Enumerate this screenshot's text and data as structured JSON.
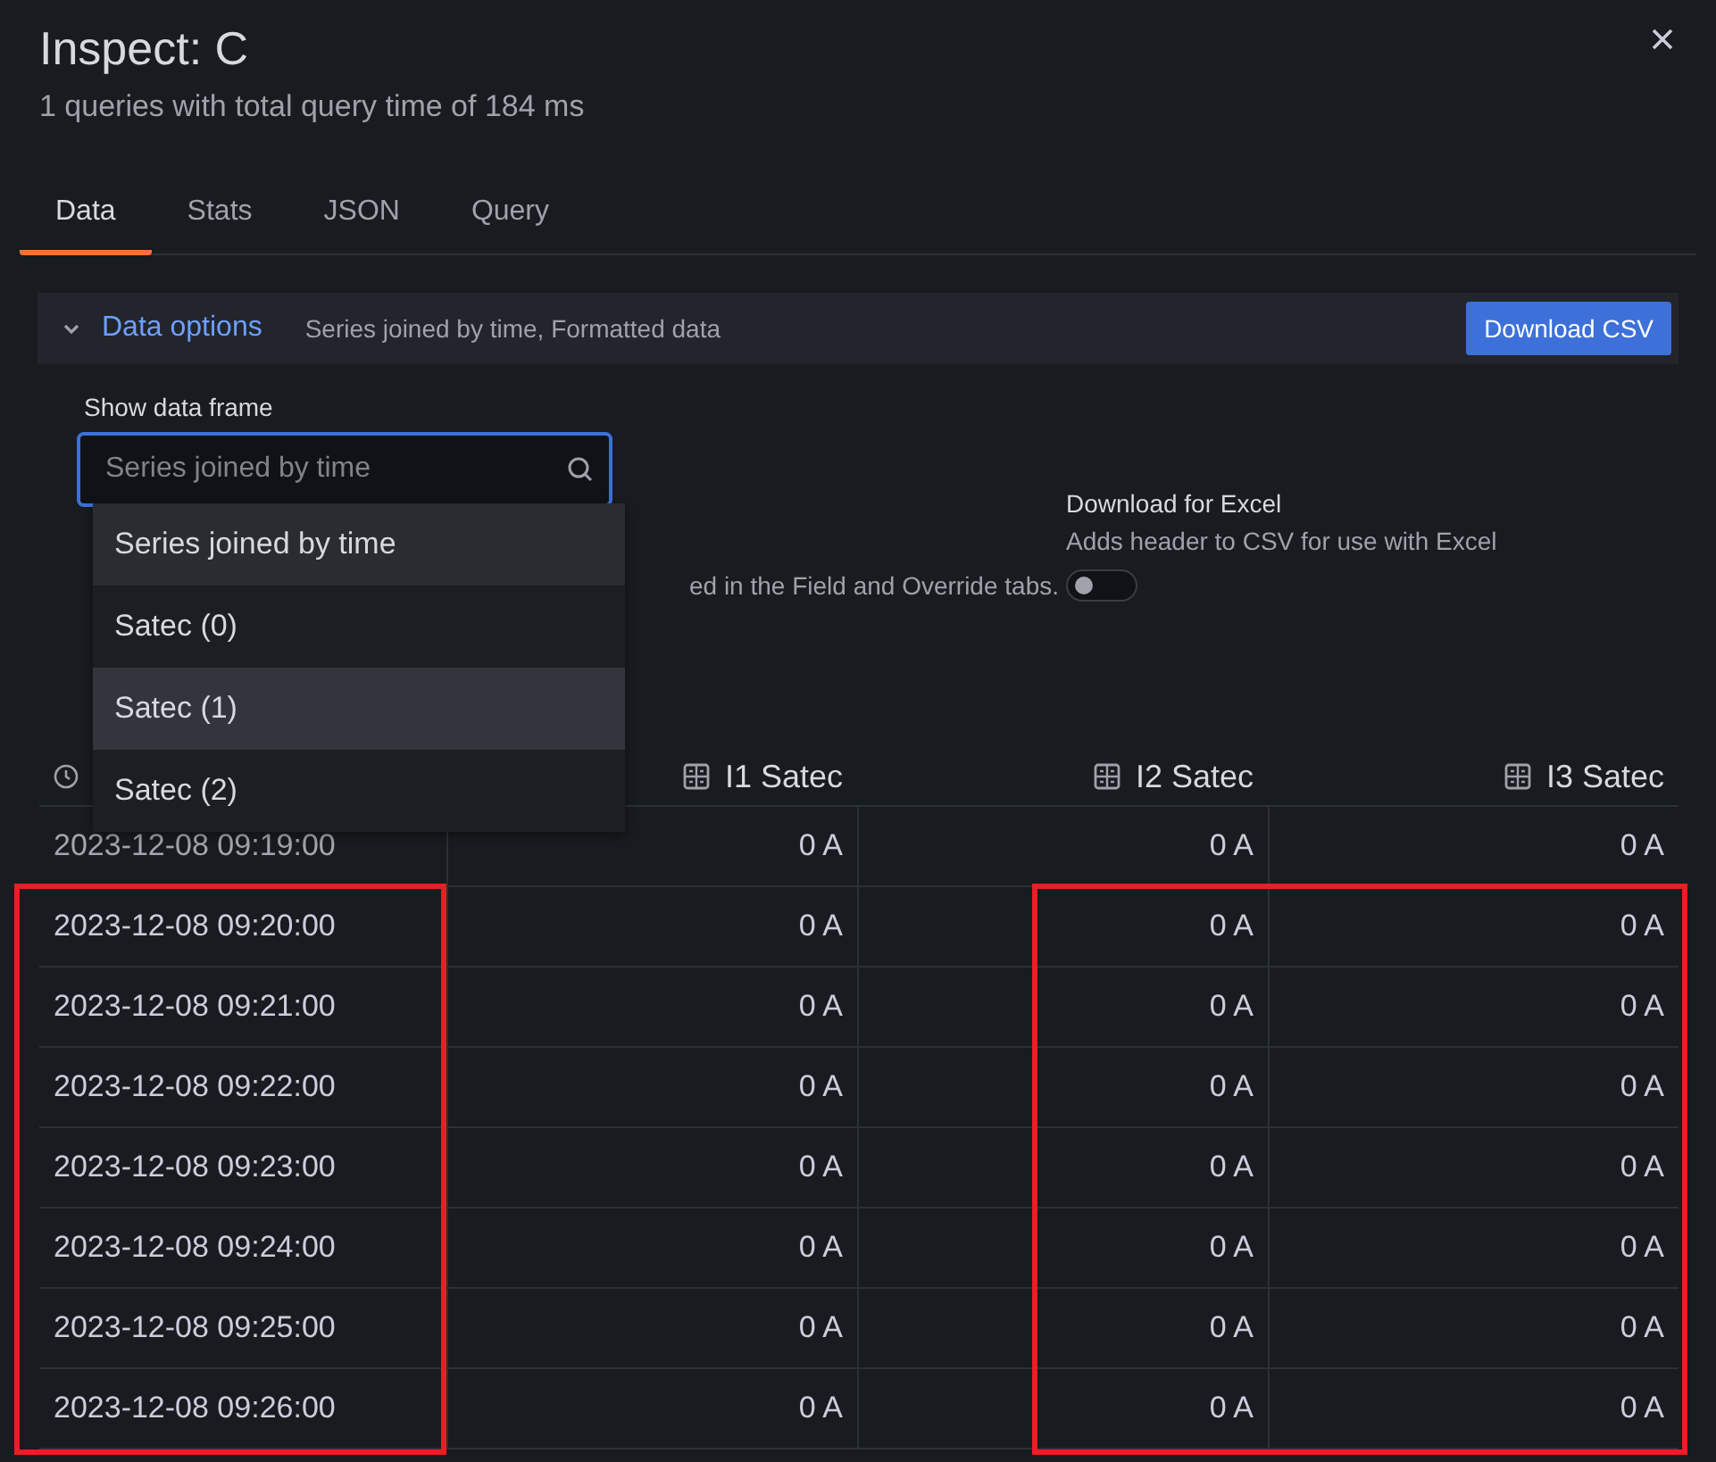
{
  "title": "Inspect: C",
  "subtitle": "1 queries with total query time of 184 ms",
  "tabs": [
    {
      "label": "Data",
      "selected": true
    },
    {
      "label": "Stats",
      "selected": false
    },
    {
      "label": "JSON",
      "selected": false
    },
    {
      "label": "Query",
      "selected": false
    }
  ],
  "data_options": {
    "label": "Data options",
    "expanded": true,
    "summary": "Series joined by time, Formatted data",
    "download_button": "Download CSV"
  },
  "frame_select": {
    "label": "Show data frame",
    "placeholder": "Series joined by time",
    "options": [
      {
        "label": "Series joined by time",
        "selected": true,
        "hovered": false
      },
      {
        "label": "Satec (0)",
        "selected": false,
        "hovered": false
      },
      {
        "label": "Satec (1)",
        "selected": false,
        "hovered": true
      },
      {
        "label": "Satec (2)",
        "selected": false,
        "hovered": false
      }
    ]
  },
  "hidden_option_text": "ed in the Field and Override tabs.",
  "excel": {
    "label": "Download for Excel",
    "description": "Adds header to CSV for use with Excel",
    "on": false
  },
  "table": {
    "columns": [
      {
        "kind": "time",
        "highlighted": true
      },
      {
        "kind": "number",
        "label": "I1 Satec",
        "highlighted": false
      },
      {
        "kind": "number",
        "label": "I2 Satec",
        "highlighted": true
      },
      {
        "kind": "number",
        "label": "I3 Satec",
        "highlighted": true
      }
    ],
    "rows": [
      {
        "highlighted": false,
        "cells": [
          "2023-12-08 09:19:00",
          "0 A",
          "0 A",
          "0 A"
        ]
      },
      {
        "highlighted": true,
        "cells": [
          "2023-12-08 09:20:00",
          "0 A",
          "0 A",
          "0 A"
        ]
      },
      {
        "highlighted": true,
        "cells": [
          "2023-12-08 09:21:00",
          "0 A",
          "0 A",
          "0 A"
        ]
      },
      {
        "highlighted": true,
        "cells": [
          "2023-12-08 09:22:00",
          "0 A",
          "0 A",
          "0 A"
        ]
      },
      {
        "highlighted": true,
        "cells": [
          "2023-12-08 09:23:00",
          "0 A",
          "0 A",
          "0 A"
        ]
      },
      {
        "highlighted": true,
        "cells": [
          "2023-12-08 09:24:00",
          "0 A",
          "0 A",
          "0 A"
        ]
      },
      {
        "highlighted": true,
        "cells": [
          "2023-12-08 09:25:00",
          "0 A",
          "0 A",
          "0 A"
        ]
      },
      {
        "highlighted": true,
        "cells": [
          "2023-12-08 09:26:00",
          "0 A",
          "0 A",
          "0 A"
        ]
      }
    ]
  }
}
